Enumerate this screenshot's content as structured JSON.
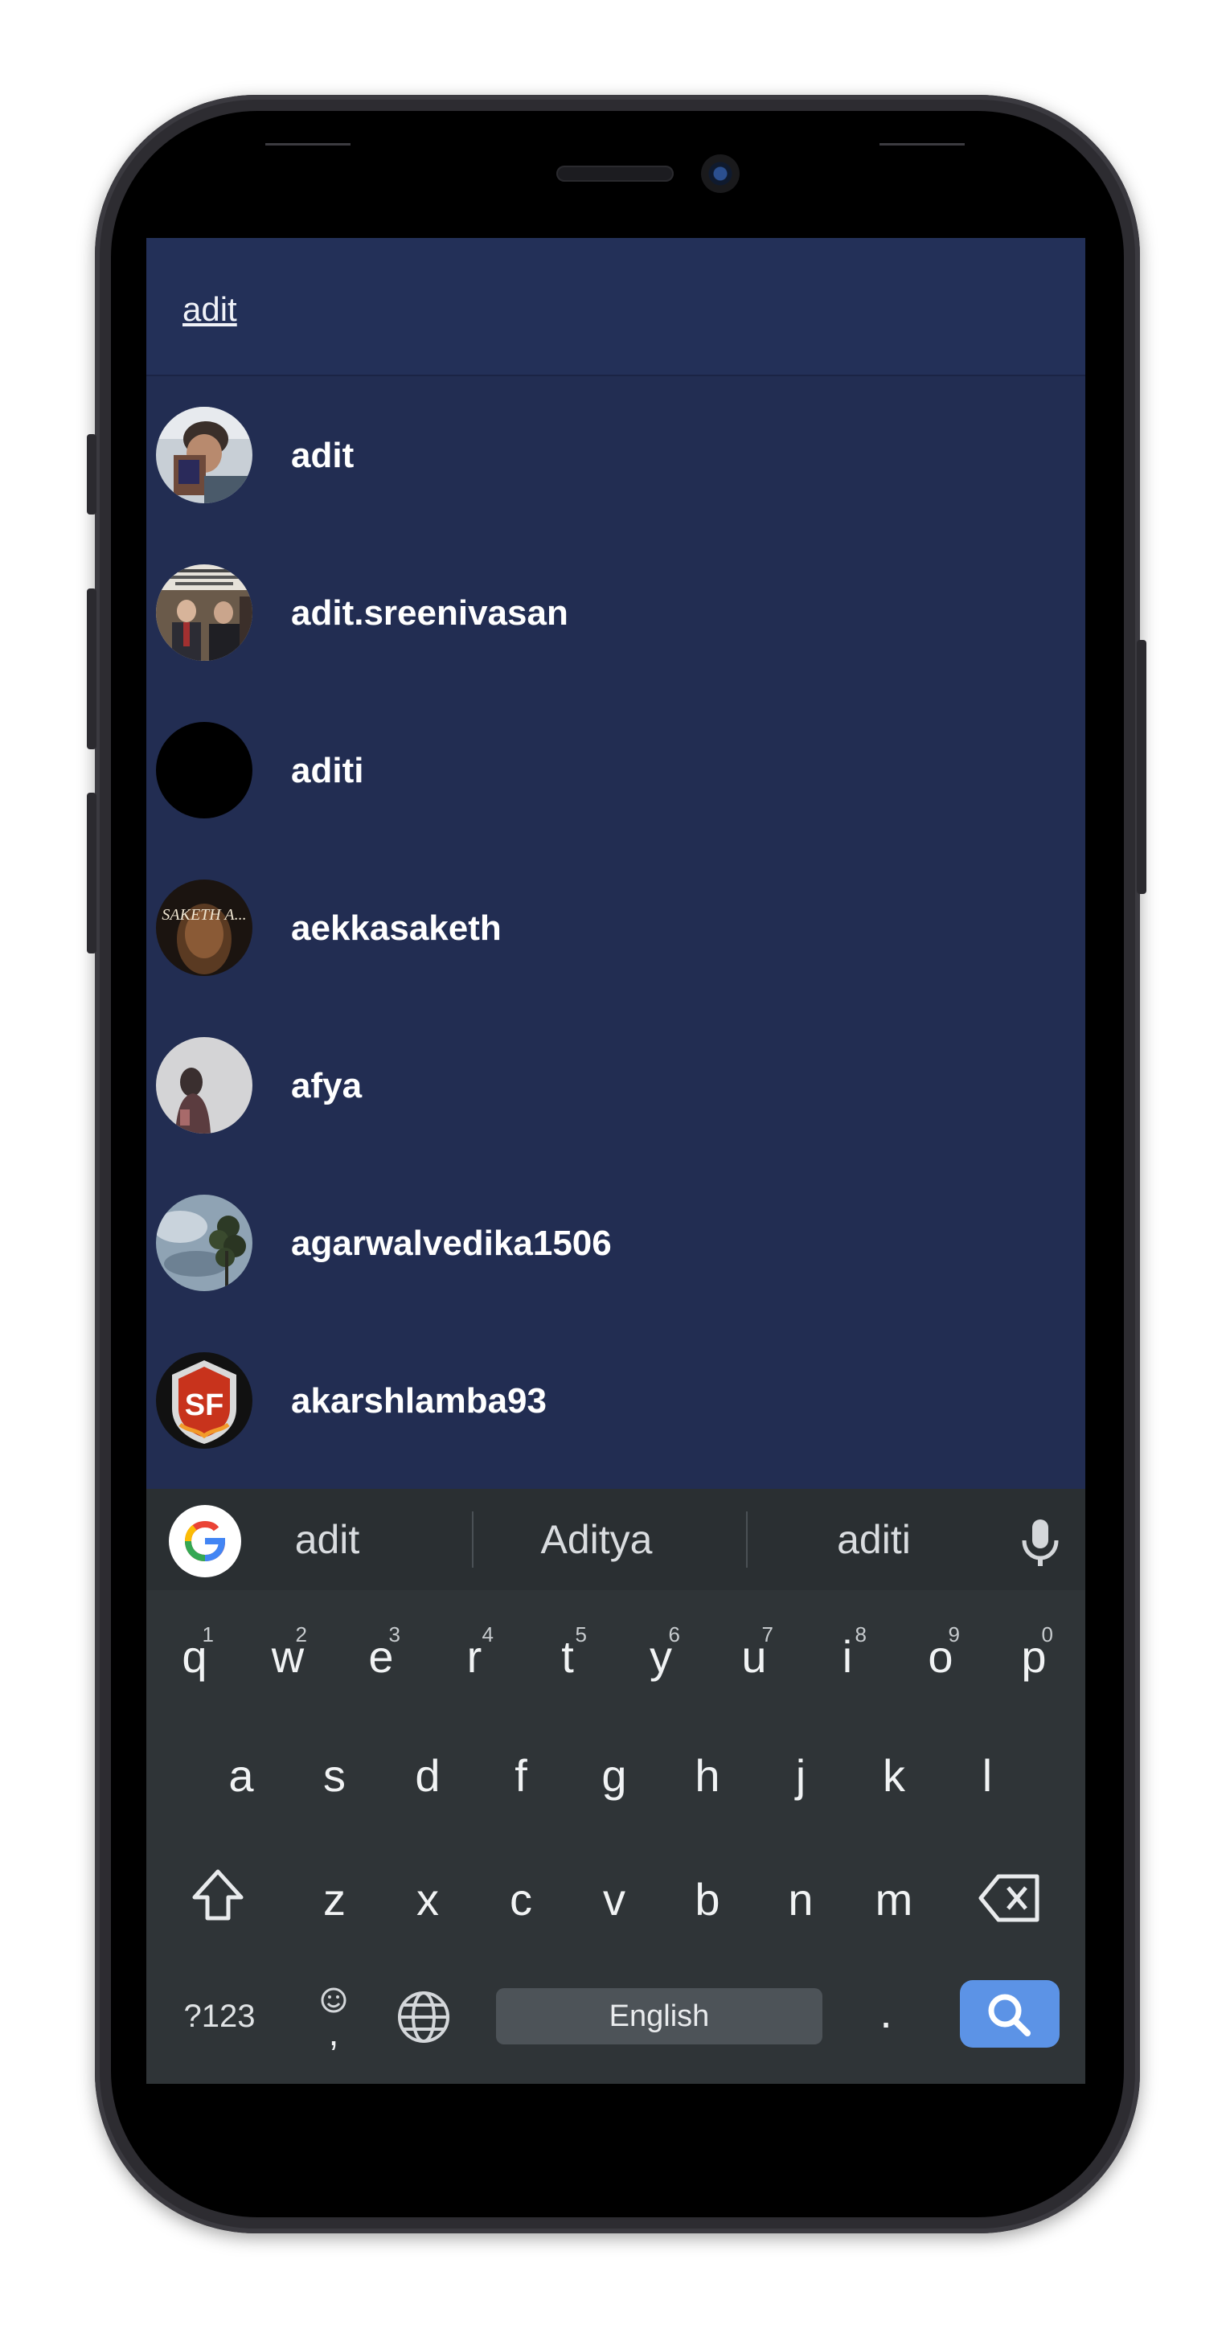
{
  "search": {
    "query": "adit"
  },
  "results": [
    {
      "username": "adit",
      "avatar": "photo-avatar"
    },
    {
      "username": "adit.sreenivasan",
      "avatar": "meme-avatar"
    },
    {
      "username": "aditi",
      "avatar": "black-avatar"
    },
    {
      "username": "aekkasaketh",
      "avatar": "portrait-avatar"
    },
    {
      "username": "afya",
      "avatar": "silhouette-avatar"
    },
    {
      "username": "agarwalvedika1506",
      "avatar": "sky-tree-avatar"
    },
    {
      "username": "akarshlamba93",
      "avatar": "sf-logo-avatar"
    }
  ],
  "avatar_overlay_text": {
    "aekkasaketh": "SAKETH A..."
  },
  "logo_text": {
    "akarshlamba93": "SF"
  },
  "keyboard": {
    "suggestions": [
      "adit",
      "Aditya",
      "aditi"
    ],
    "row1": [
      {
        "key": "q",
        "hint": "1"
      },
      {
        "key": "w",
        "hint": "2"
      },
      {
        "key": "e",
        "hint": "3"
      },
      {
        "key": "r",
        "hint": "4"
      },
      {
        "key": "t",
        "hint": "5"
      },
      {
        "key": "y",
        "hint": "6"
      },
      {
        "key": "u",
        "hint": "7"
      },
      {
        "key": "i",
        "hint": "8"
      },
      {
        "key": "o",
        "hint": "9"
      },
      {
        "key": "p",
        "hint": "0"
      }
    ],
    "row2": [
      "a",
      "s",
      "d",
      "f",
      "g",
      "h",
      "j",
      "k",
      "l"
    ],
    "row3": [
      "z",
      "x",
      "c",
      "v",
      "b",
      "n",
      "m"
    ],
    "symbols_label": "?123",
    "comma_label": ",",
    "period_label": ".",
    "space_label": "English"
  },
  "colors": {
    "screen_bg": "#222d52",
    "search_bar_bg": "#233058",
    "keyboard_bg": "#2f3437",
    "search_key": "#5c93e6"
  }
}
